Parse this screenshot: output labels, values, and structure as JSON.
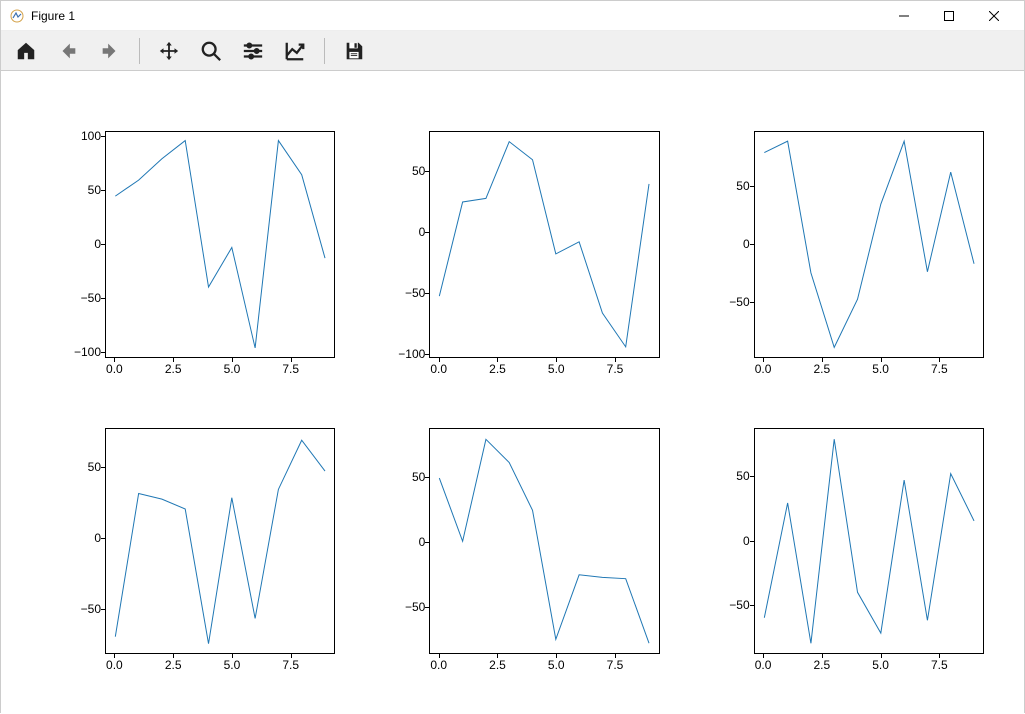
{
  "window": {
    "title": "Figure 1"
  },
  "toolbar": {
    "home": "Home",
    "back": "Back",
    "forward": "Forward",
    "pan": "Pan",
    "zoom": "Zoom",
    "configure": "Configure subplots",
    "edit": "Edit axis",
    "save": "Save"
  },
  "colors": {
    "line": "#1f77b4"
  },
  "chart_data": [
    {
      "type": "line",
      "x": [
        0,
        1,
        2,
        3,
        4,
        5,
        6,
        7,
        8,
        9
      ],
      "values": [
        45,
        60,
        80,
        97,
        -40,
        -3,
        -97,
        97,
        65,
        -13
      ],
      "xticks": [
        "0.0",
        "2.5",
        "5.0",
        "7.5"
      ],
      "yticks": [
        "-100",
        "-50",
        "0",
        "50",
        "100"
      ],
      "xlim": [
        -0.4,
        9.4
      ],
      "ylim": [
        -105,
        105
      ]
    },
    {
      "type": "line",
      "x": [
        0,
        1,
        2,
        3,
        4,
        5,
        6,
        7,
        8,
        9
      ],
      "values": [
        -53,
        25,
        28,
        75,
        60,
        -18,
        -8,
        -67,
        -95,
        40
      ],
      "xticks": [
        "0.0",
        "2.5",
        "5.0",
        "7.5"
      ],
      "yticks": [
        "-100",
        "-50",
        "0",
        "50"
      ],
      "xlim": [
        -0.4,
        9.4
      ],
      "ylim": [
        -103,
        83
      ]
    },
    {
      "type": "line",
      "x": [
        0,
        1,
        2,
        3,
        4,
        5,
        6,
        7,
        8,
        9
      ],
      "values": [
        80,
        90,
        -25,
        -90,
        -48,
        35,
        90,
        -24,
        63,
        -17
      ],
      "xticks": [
        "0.0",
        "2.5",
        "5.0",
        "7.5"
      ],
      "yticks": [
        "-50",
        "0",
        "50"
      ],
      "xlim": [
        -0.4,
        9.4
      ],
      "ylim": [
        -98,
        98
      ]
    },
    {
      "type": "line",
      "x": [
        0,
        1,
        2,
        3,
        4,
        5,
        6,
        7,
        8,
        9
      ],
      "values": [
        -70,
        32,
        28,
        21,
        -75,
        29,
        -57,
        35,
        70,
        48
      ],
      "xticks": [
        "0.0",
        "2.5",
        "5.0",
        "7.5"
      ],
      "yticks": [
        "-50",
        "0",
        "50"
      ],
      "xlim": [
        -0.4,
        9.4
      ],
      "ylim": [
        -82,
        78
      ]
    },
    {
      "type": "line",
      "x": [
        0,
        1,
        2,
        3,
        4,
        5,
        6,
        7,
        8,
        9
      ],
      "values": [
        50,
        1,
        80,
        62,
        25,
        -75,
        -25,
        -27,
        -28,
        -78
      ],
      "xticks": [
        "0.0",
        "2.5",
        "5.0",
        "7.5"
      ],
      "yticks": [
        "-50",
        "0",
        "50"
      ],
      "xlim": [
        -0.4,
        9.4
      ],
      "ylim": [
        -86,
        88
      ]
    },
    {
      "type": "line",
      "x": [
        0,
        1,
        2,
        3,
        4,
        5,
        6,
        7,
        8,
        9
      ],
      "values": [
        -60,
        30,
        -80,
        80,
        -40,
        -72,
        48,
        -62,
        53,
        16
      ],
      "xticks": [
        "0.0",
        "2.5",
        "5.0",
        "7.5"
      ],
      "yticks": [
        "-50",
        "0",
        "50"
      ],
      "xlim": [
        -0.4,
        9.4
      ],
      "ylim": [
        -88,
        88
      ]
    }
  ]
}
